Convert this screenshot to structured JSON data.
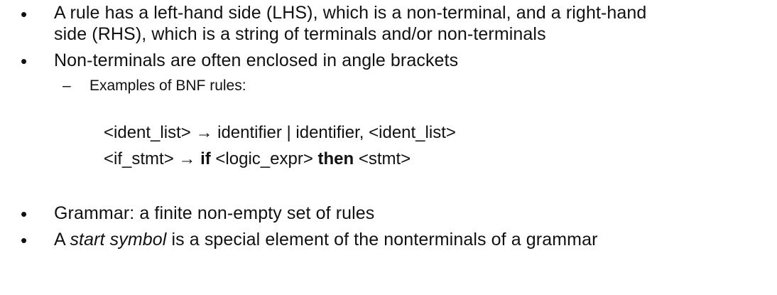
{
  "bullets": [
    {
      "line1": "A rule has a left-hand side (LHS), which is a non-terminal, and a right-hand",
      "line2": "side (RHS), which is a string of terminals and/or non-terminals"
    },
    {
      "text": "Non-terminals are often enclosed in angle brackets"
    },
    {
      "text": "Grammar: a finite non-empty set of rules"
    },
    {
      "prefix": "A ",
      "emphasis": "start symbol",
      "suffix": " is a special element of the nonterminals of a grammar"
    }
  ],
  "bullet_symbol": "•",
  "sub_bullet": {
    "dash": "–",
    "text": "Examples of BNF rules:"
  },
  "rules": [
    {
      "lhs": "<ident_list>",
      "arrow": "→",
      "rhs": " identifier | identifier, <ident_list>"
    },
    {
      "lhs": "<if_stmt>",
      "arrow": "→",
      "kw1": "if",
      "mid": " <logic_expr> ",
      "kw2": "then",
      "tail": " <stmt>"
    }
  ]
}
